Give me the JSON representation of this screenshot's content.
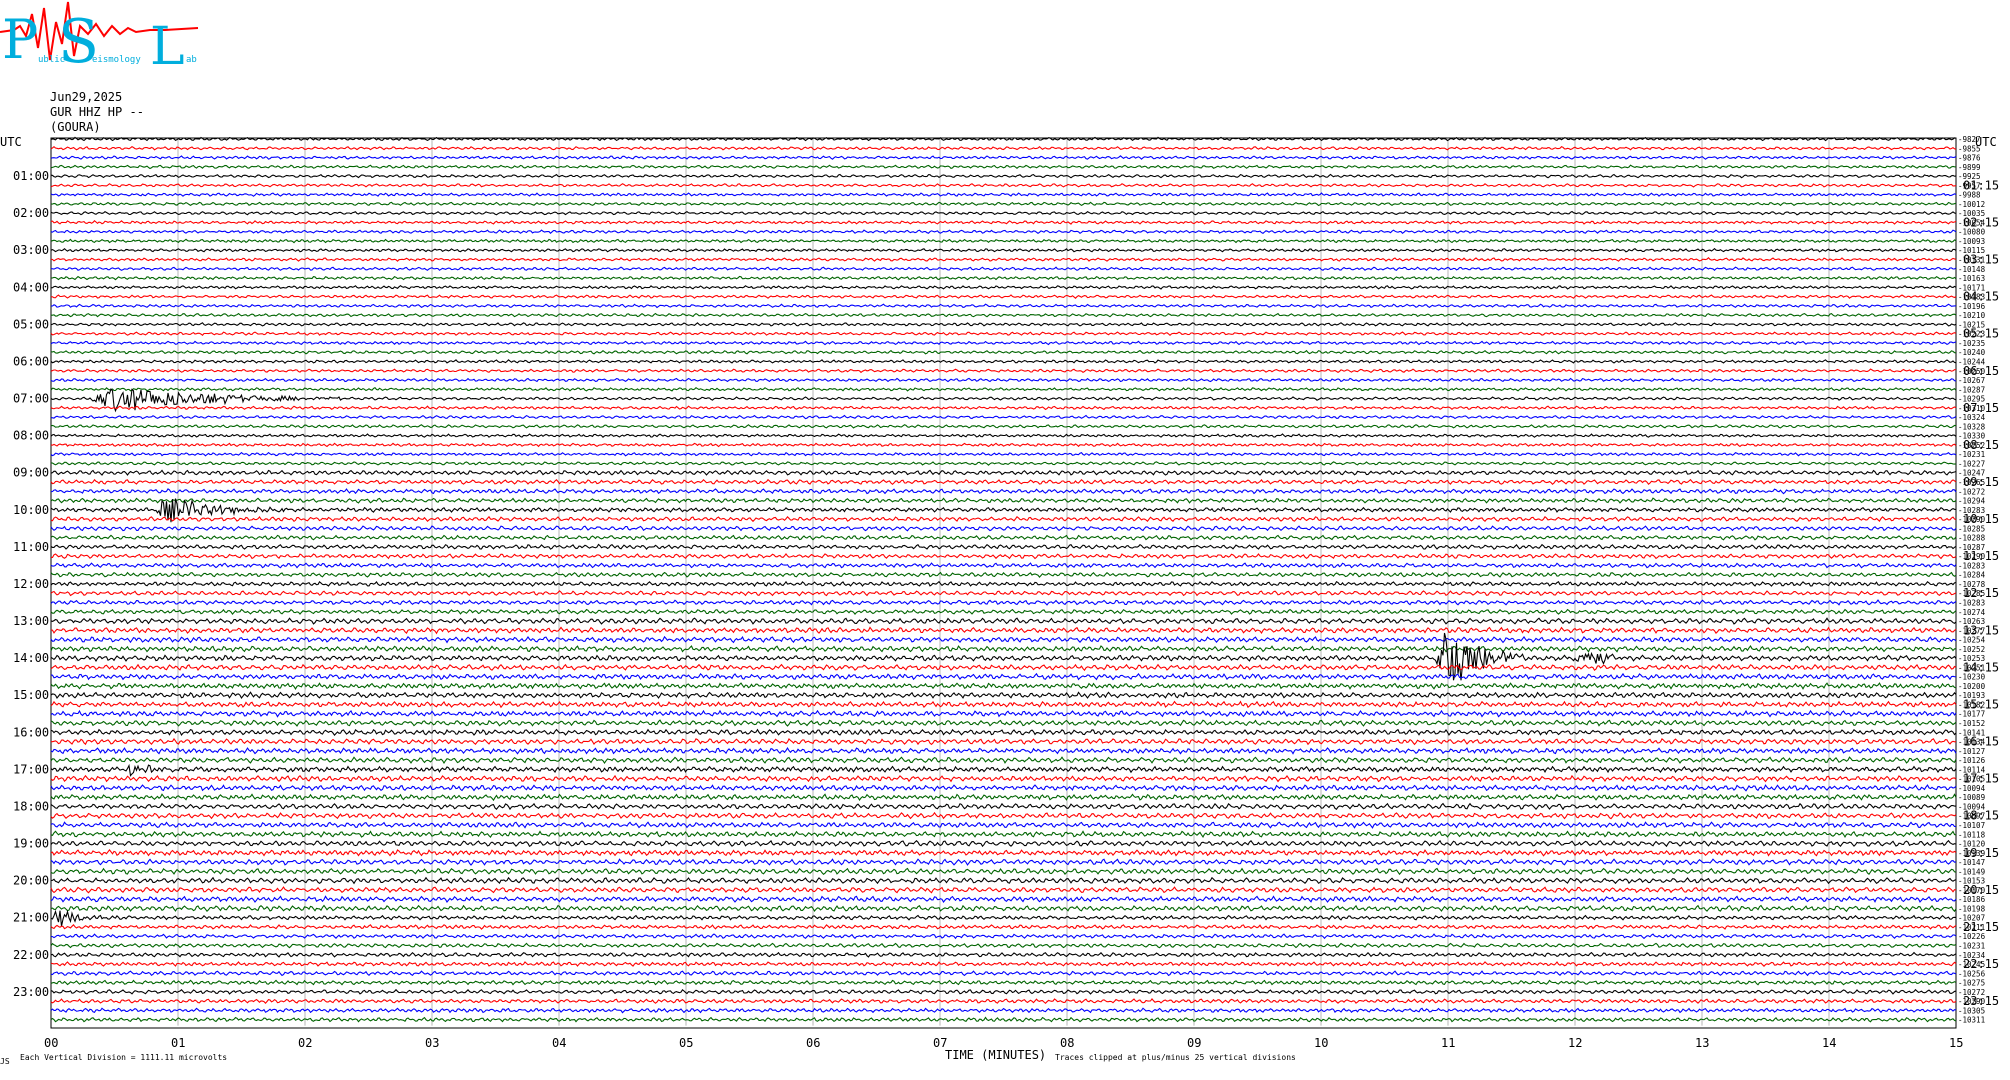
{
  "logo": {
    "letters": [
      "P",
      "S",
      "L"
    ],
    "small_text": [
      "ublic",
      "eismology",
      "ab"
    ],
    "colors": [
      "#00aedd",
      "#ff0000"
    ]
  },
  "header": {
    "date": "Jun29,2025",
    "station": "GUR HHZ HP --",
    "location": "(GOURA)"
  },
  "left_header": "UTC",
  "right_header": "UTC",
  "footer": {
    "division_note": "Each Vertical Division = 1111.11 microvolts",
    "x_axis_title": "TIME (MINUTES)",
    "clip_note": "Traces clipped at plus/minus 25 vertical divisions",
    "corner_mark": "JS"
  },
  "colors": {
    "cycle": [
      "#000000",
      "#ff0000",
      "#0000ff",
      "#006400"
    ],
    "grid": "#999999"
  },
  "chart_data": {
    "type": "helicorder",
    "x_unit": "minutes",
    "xlim": [
      0,
      15
    ],
    "x_ticks": [
      "00",
      "01",
      "02",
      "03",
      "04",
      "05",
      "06",
      "07",
      "08",
      "09",
      "10",
      "11",
      "12",
      "13",
      "14",
      "15"
    ],
    "left_hour_labels": [
      "01:00",
      "02:00",
      "03:00",
      "04:00",
      "05:00",
      "06:00",
      "07:00",
      "08:00",
      "09:00",
      "10:00",
      "11:00",
      "12:00",
      "13:00",
      "14:00",
      "15:00",
      "16:00",
      "17:00",
      "18:00",
      "19:00",
      "20:00",
      "21:00",
      "22:00",
      "23:00"
    ],
    "right_hour_labels": [
      "01:15",
      "02:15",
      "03:15",
      "04:15",
      "05:15",
      "06:15",
      "07:15",
      "08:15",
      "09:15",
      "10:15",
      "11:15",
      "12:15",
      "13:15",
      "14:15",
      "15:15",
      "16:15",
      "17:15",
      "18:15",
      "19:15",
      "20:15",
      "21:15",
      "22:15",
      "23:15"
    ],
    "traces_per_hour": 4,
    "trace_count": 96,
    "right_counts": [
      -9827,
      -9855,
      -9876,
      -9899,
      -9925,
      -9957,
      -9988,
      -10012,
      -10035,
      -10054,
      -10080,
      -10093,
      -10115,
      -10131,
      -10148,
      -10163,
      -10171,
      -10183,
      -10196,
      -10210,
      -10215,
      -10223,
      -10235,
      -10240,
      -10244,
      -10250,
      -10267,
      -10287,
      -10295,
      -10310,
      -10324,
      -10328,
      -10330,
      -10252,
      -10231,
      -10227,
      -10247,
      -10265,
      -10272,
      -10294,
      -10283,
      -10290,
      -10285,
      -10288,
      -10287,
      -10290,
      -10283,
      -10284,
      -10278,
      -10285,
      -10283,
      -10274,
      -10263,
      -10277,
      -10254,
      -10252,
      -10253,
      -10251,
      -10230,
      -10200,
      -10193,
      -10182,
      -10177,
      -10152,
      -10141,
      -10134,
      -10127,
      -10126,
      -10114,
      -10105,
      -10094,
      -10089,
      -10094,
      -10097,
      -10107,
      -10118,
      -10120,
      -10139,
      -10147,
      -10149,
      -10153,
      -10170,
      -10186,
      -10198,
      -10207,
      -10211,
      -10226,
      -10231,
      -10234,
      -10245,
      -10256,
      -10275,
      -10272,
      -10290,
      -10305,
      -10311
    ],
    "events": [
      {
        "hour": 7,
        "start_min": 0.3,
        "end_min": 2.3,
        "peak_divisions": 9
      },
      {
        "hour": 10,
        "start_min": 0.8,
        "end_min": 1.9,
        "peak_divisions": 8
      },
      {
        "hour": 14,
        "start_min": 10.9,
        "end_min": 11.6,
        "peak_divisions": 25
      },
      {
        "hour": 14,
        "start_min": 12.0,
        "end_min": 12.4,
        "peak_divisions": 10
      },
      {
        "hour": 17,
        "start_min": 0.6,
        "end_min": 0.95,
        "peak_divisions": 5
      },
      {
        "hour": 21,
        "start_min": 0.0,
        "end_min": 0.5,
        "peak_divisions": 6
      }
    ]
  }
}
